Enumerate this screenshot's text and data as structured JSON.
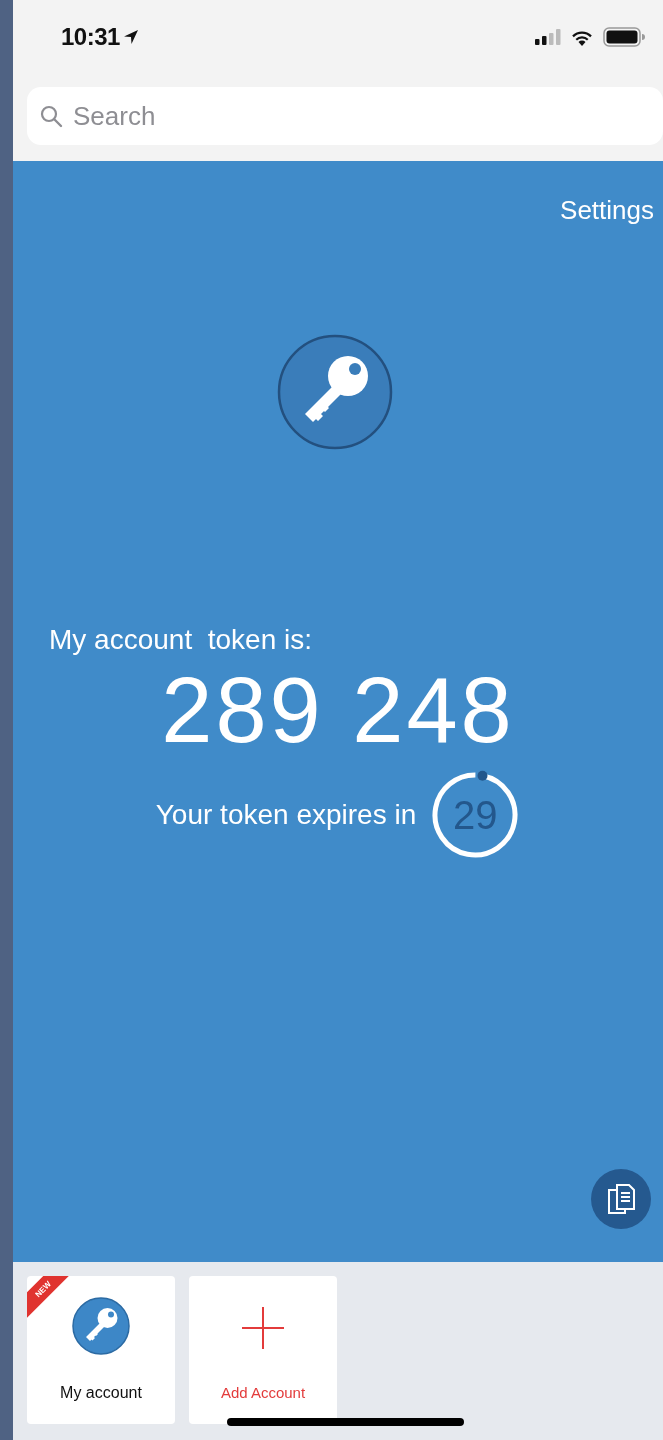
{
  "status_bar": {
    "time": "10:31"
  },
  "search": {
    "placeholder": "Search"
  },
  "header": {
    "settings": "Settings"
  },
  "token": {
    "label": "My account  token is:",
    "code": "289 248",
    "expires_label": "Your token expires in",
    "seconds": "29",
    "level": 0.97
  },
  "accounts": [
    {
      "kind": "account",
      "name": "My account",
      "badge": "NEW"
    },
    {
      "kind": "add",
      "name": "Add Account"
    }
  ]
}
